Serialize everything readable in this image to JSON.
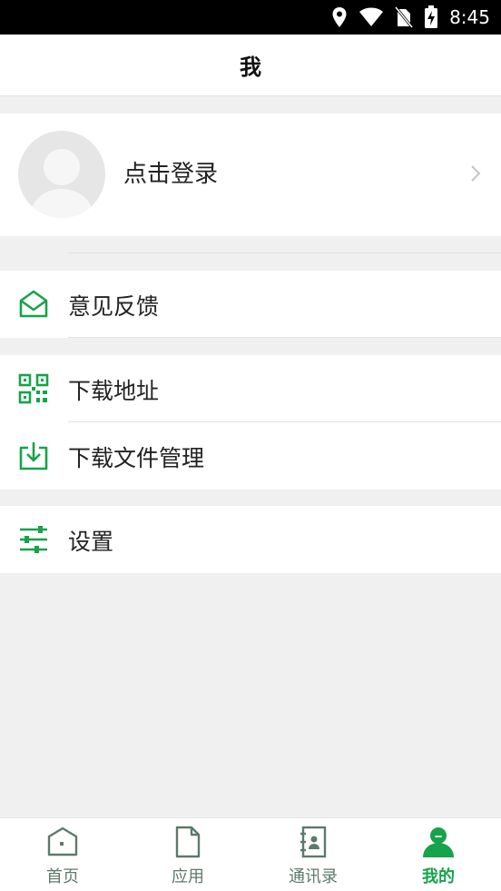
{
  "status_bar": {
    "time": "8:45"
  },
  "header": {
    "title": "我"
  },
  "profile": {
    "login_label": "点击登录"
  },
  "menu": {
    "feedback": "意见反馈",
    "download_address": "下载地址",
    "download_manager": "下载文件管理",
    "settings": "设置"
  },
  "tabs": [
    {
      "label": "首页",
      "icon": "home-icon"
    },
    {
      "label": "应用",
      "icon": "document-icon"
    },
    {
      "label": "通讯录",
      "icon": "contacts-icon"
    },
    {
      "label": "我的",
      "icon": "person-icon"
    }
  ],
  "colors": {
    "accent": "#16a34a",
    "inactive_tab": "#5d7a6a"
  }
}
